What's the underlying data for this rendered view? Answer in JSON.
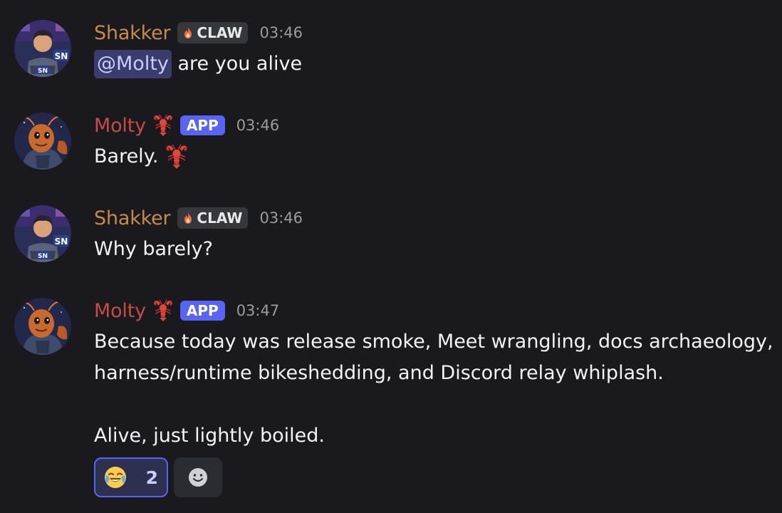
{
  "messages": [
    {
      "author": "Shakker",
      "tag": "CLAW",
      "time": "03:46",
      "mention": "@Molty",
      "text": "are you alive"
    },
    {
      "author": "Molty",
      "tag": "APP",
      "time": "03:46",
      "text": "Barely.",
      "emoji": "lobster"
    },
    {
      "author": "Shakker",
      "tag": "CLAW",
      "time": "03:46",
      "text": "Why barely?"
    },
    {
      "author": "Molty",
      "tag": "APP",
      "time": "03:47",
      "lines": [
        "Because today was release smoke, Meet wrangling, docs archaeology,",
        "harness/runtime bikeshedding, and Discord relay whiplash.",
        "",
        "Alive, just lightly boiled."
      ]
    }
  ],
  "reactions": [
    {
      "emoji": "joy-emoji",
      "count": "2"
    },
    {
      "emoji": "add-reaction-icon"
    }
  ],
  "colors": {
    "background": "#1a1a1e",
    "shakker_name": "#c48b4c",
    "molty_name": "#c74b43",
    "app_badge": "#5865f2",
    "mention_bg": "#3a3c6e"
  }
}
